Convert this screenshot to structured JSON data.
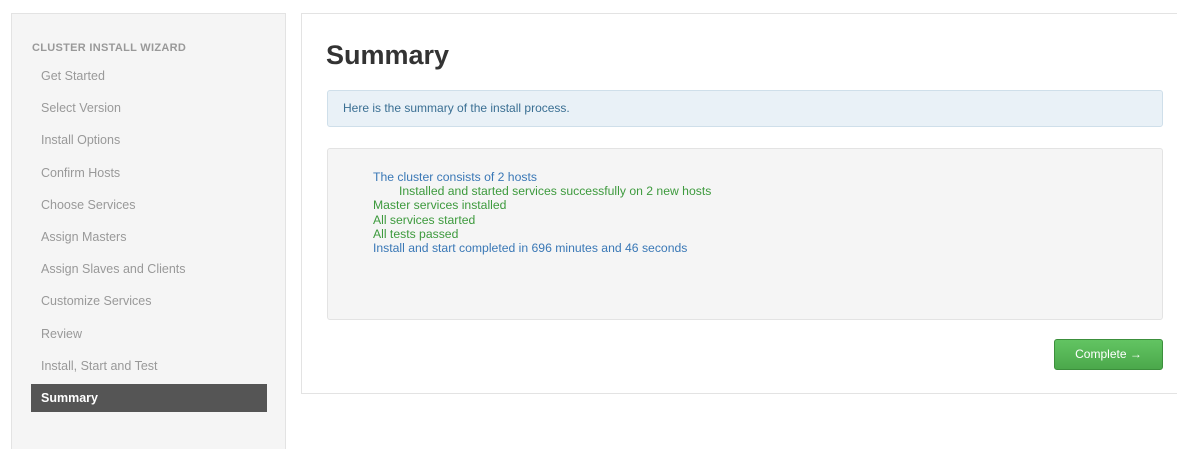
{
  "sidebar": {
    "title": "CLUSTER INSTALL WIZARD",
    "items": [
      {
        "label": "Get Started"
      },
      {
        "label": "Select Version"
      },
      {
        "label": "Install Options"
      },
      {
        "label": "Confirm Hosts"
      },
      {
        "label": "Choose Services"
      },
      {
        "label": "Assign Masters"
      },
      {
        "label": "Assign Slaves and Clients"
      },
      {
        "label": "Customize Services"
      },
      {
        "label": "Review"
      },
      {
        "label": "Install, Start and Test"
      },
      {
        "label": "Summary",
        "active": true
      }
    ]
  },
  "main": {
    "title": "Summary",
    "info_text": "Here is the summary of the install process.",
    "results": [
      {
        "text": "The cluster consists of 2 hosts",
        "color": "#3a78b6"
      },
      {
        "text": "Installed and started services successfully on 2 new hosts",
        "color": "#3d9a3d",
        "indented": true
      },
      {
        "text": "Master services installed",
        "color": "#3d9a3d"
      },
      {
        "text": "All services started",
        "color": "#3d9a3d"
      },
      {
        "text": "All tests passed",
        "color": "#3d9a3d"
      },
      {
        "text": "Install and start completed in 696 minutes and 46 seconds",
        "color": "#3a78b6"
      }
    ],
    "complete_label": "Complete →"
  }
}
